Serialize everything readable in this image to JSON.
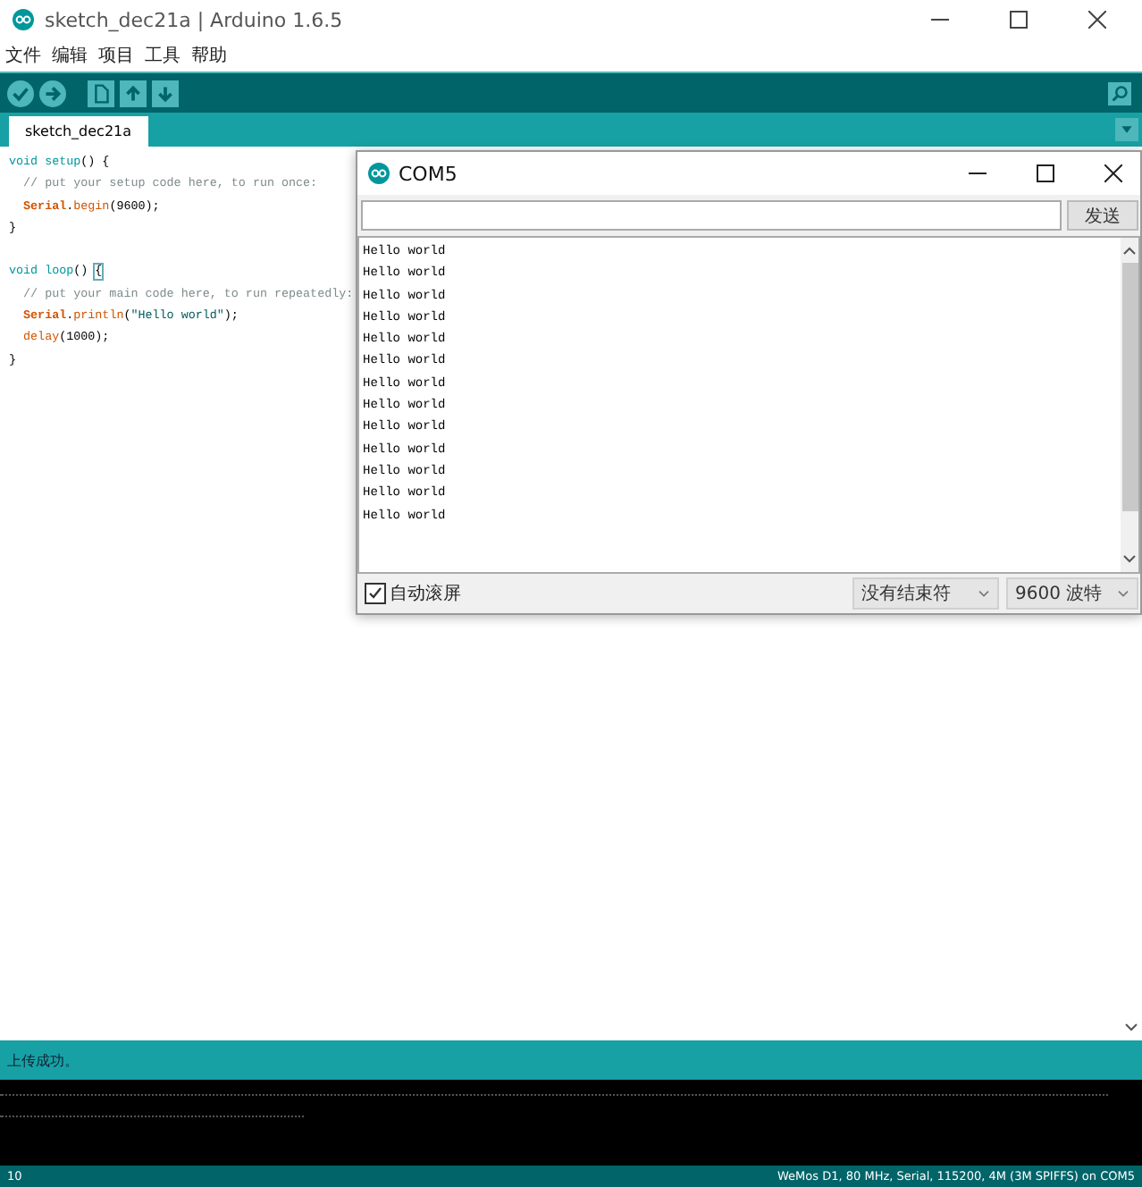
{
  "window": {
    "title": "sketch_dec21a | Arduino 1.6.5"
  },
  "menu": [
    "文件",
    "编辑",
    "项目",
    "工具",
    "帮助"
  ],
  "tabs": [
    {
      "label": "sketch_dec21a",
      "selected": true
    }
  ],
  "code": [
    {
      "kind": "code",
      "tokens": [
        {
          "kind": "keyword",
          "text": "void setup"
        },
        {
          "kind": "plain",
          "text": "() {"
        }
      ]
    },
    {
      "kind": "code",
      "tokens": [
        {
          "kind": "comment",
          "text": "  // put your setup code here, to run once:"
        }
      ]
    },
    {
      "kind": "code",
      "tokens": [
        {
          "kind": "class",
          "text": "  Serial"
        },
        {
          "kind": "plain",
          "text": "."
        },
        {
          "kind": "method",
          "text": "begin"
        },
        {
          "kind": "plain",
          "text": "(9600);"
        }
      ]
    },
    {
      "kind": "code",
      "tokens": [
        {
          "kind": "plain",
          "text": "}"
        }
      ]
    },
    {
      "kind": "blank"
    },
    {
      "kind": "code",
      "tokens": [
        {
          "kind": "keyword",
          "text": "void loop"
        },
        {
          "kind": "plain",
          "text": "() "
        },
        {
          "kind": "match",
          "text": "{"
        }
      ]
    },
    {
      "kind": "code",
      "tokens": [
        {
          "kind": "comment",
          "text": "  // put your main code here, to run repeatedly:"
        }
      ]
    },
    {
      "kind": "code",
      "tokens": [
        {
          "kind": "class",
          "text": "  Serial"
        },
        {
          "kind": "plain",
          "text": "."
        },
        {
          "kind": "method",
          "text": "println"
        },
        {
          "kind": "plain",
          "text": "("
        },
        {
          "kind": "string",
          "text": "\"Hello world\""
        },
        {
          "kind": "plain",
          "text": ");"
        }
      ]
    },
    {
      "kind": "code",
      "tokens": [
        {
          "kind": "method",
          "text": "  delay"
        },
        {
          "kind": "plain",
          "text": "(1000);"
        }
      ]
    },
    {
      "kind": "code",
      "tokens": [
        {
          "kind": "plain",
          "text": "}"
        }
      ]
    }
  ],
  "serial_monitor": {
    "title": "COM5",
    "send_button": "发送",
    "output": [
      "Hello world",
      "Hello world",
      "Hello world",
      "Hello world",
      "Hello world",
      "Hello world",
      "Hello world",
      "Hello world",
      "Hello world",
      "Hello world",
      "Hello world",
      "Hello world",
      "Hello world"
    ],
    "autoscroll": {
      "label": "自动滚屏",
      "checked": true
    },
    "line_ending": "没有结束符",
    "baud_rate": "9600 波特"
  },
  "status_message": "上传成功。",
  "status_bar": {
    "line": "10",
    "board": "WeMos D1, 80 MHz, Serial, 115200, 4M (3M SPIFFS) on COM5"
  }
}
